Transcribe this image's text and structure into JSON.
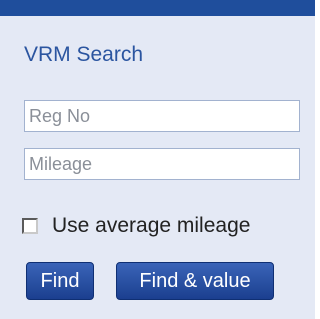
{
  "panel": {
    "title": "VRM Search"
  },
  "fields": {
    "reg_no_placeholder": "Reg No",
    "mileage_placeholder": "Mileage"
  },
  "option": {
    "label": "Use average mileage",
    "checked": false
  },
  "buttons": {
    "find_label": "Find",
    "find_value_label": "Find & value"
  },
  "colors": {
    "top_bar": "#1f4e9c",
    "panel_bg": "#e4e9f5",
    "title_text": "#2b55a0",
    "button_bg": "#1b3f8f"
  }
}
